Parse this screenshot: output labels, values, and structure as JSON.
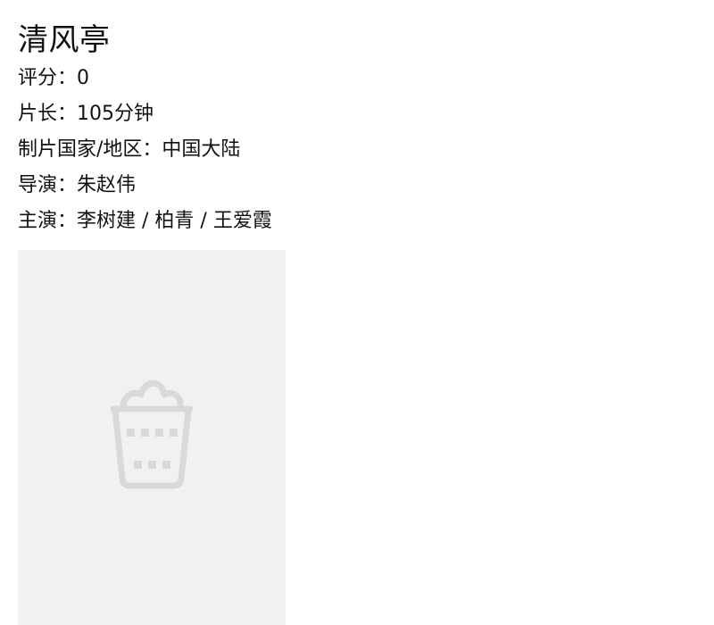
{
  "movie": {
    "title": "清风亭",
    "rating_label": "评分：",
    "rating_value": "0",
    "runtime_label": "片长：",
    "runtime_value": "105分钟",
    "country_label": "制片国家/地区：",
    "country_value": "中国大陆",
    "director_label": "导演：",
    "director_value": "朱赵伟",
    "cast_label": "主演：",
    "cast_value": "李树建 / 柏青 / 王爱霞"
  },
  "poster": {
    "placeholder_icon": "popcorn-placeholder-icon",
    "background_color": "#f1f1f1",
    "icon_color": "#d9d9d9"
  }
}
